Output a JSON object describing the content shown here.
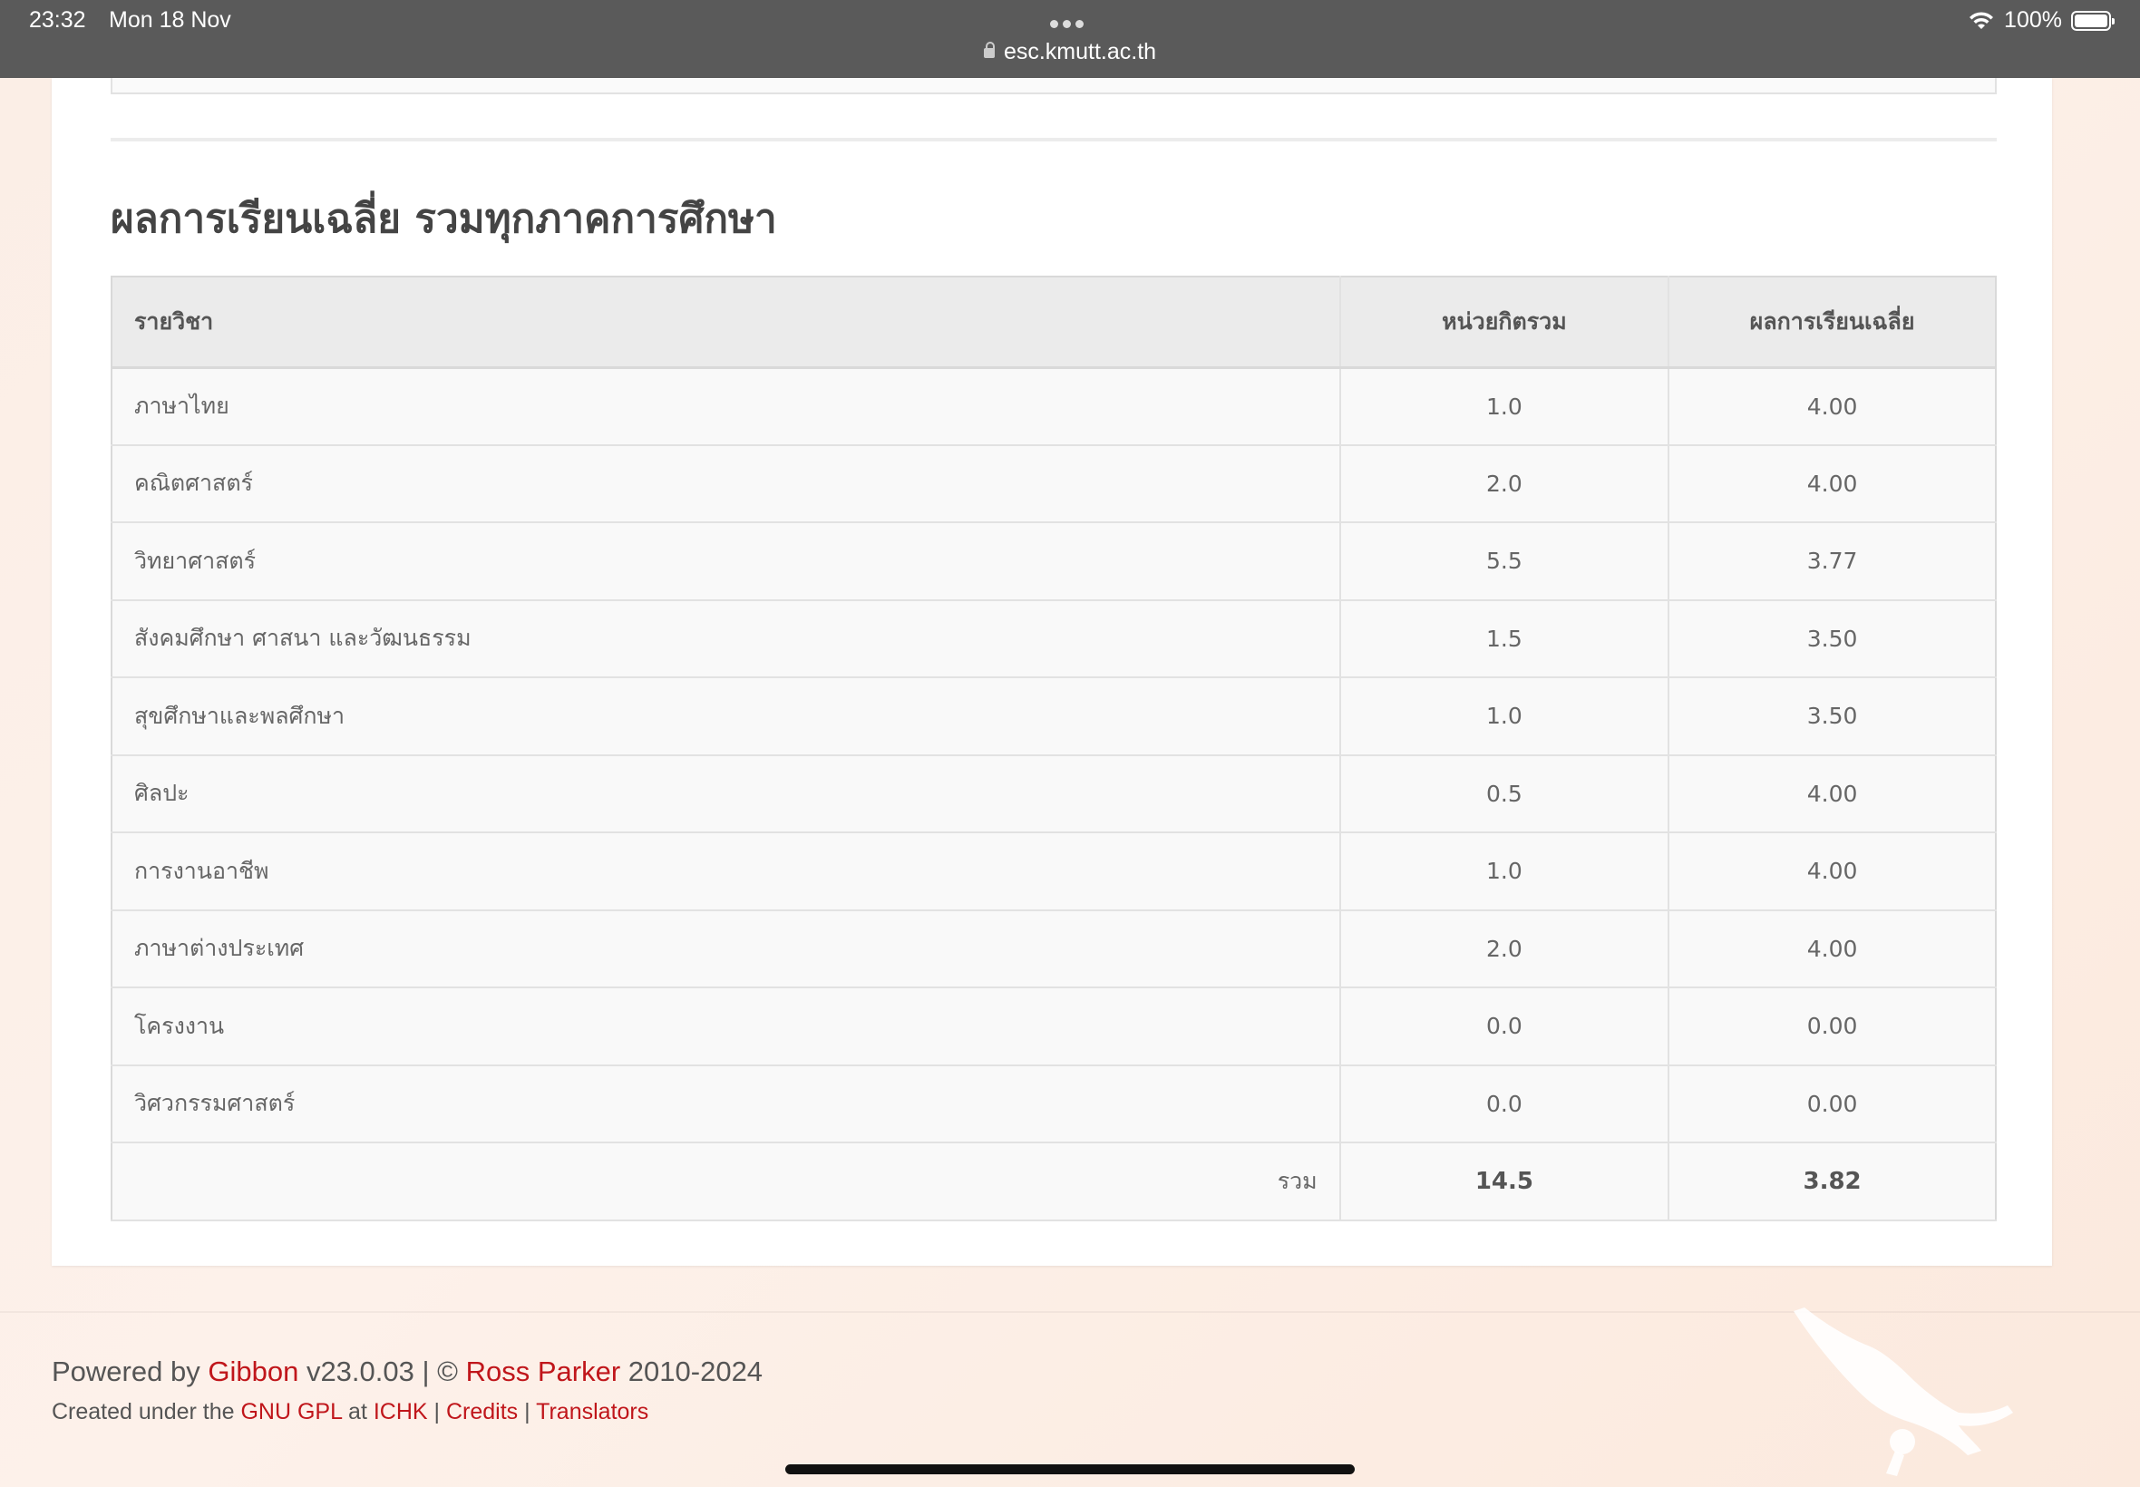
{
  "status_bar": {
    "time": "23:32",
    "date": "Mon 18 Nov",
    "url": "esc.kmutt.ac.th",
    "battery": "100%"
  },
  "section": {
    "title": "ผลการเรียนเฉลี่ย รวมทุกภาคการศึกษา"
  },
  "table": {
    "headers": {
      "subject": "รายวิชา",
      "credits": "หน่วยกิตรวม",
      "gpa": "ผลการเรียนเฉลี่ย"
    },
    "rows": [
      {
        "subject": "ภาษาไทย",
        "credits": "1.0",
        "gpa": "4.00"
      },
      {
        "subject": "คณิตศาสตร์",
        "credits": "2.0",
        "gpa": "4.00"
      },
      {
        "subject": "วิทยาศาสตร์",
        "credits": "5.5",
        "gpa": "3.77"
      },
      {
        "subject": "สังคมศึกษา ศาสนา และวัฒนธรรม",
        "credits": "1.5",
        "gpa": "3.50"
      },
      {
        "subject": "สุขศึกษาและพลศึกษา",
        "credits": "1.0",
        "gpa": "3.50"
      },
      {
        "subject": "ศิลปะ",
        "credits": "0.5",
        "gpa": "4.00"
      },
      {
        "subject": "การงานอาชีพ",
        "credits": "1.0",
        "gpa": "4.00"
      },
      {
        "subject": "ภาษาต่างประเทศ",
        "credits": "2.0",
        "gpa": "4.00"
      },
      {
        "subject": "โครงงาน",
        "credits": "0.0",
        "gpa": "0.00"
      },
      {
        "subject": "วิศวกรรมศาสตร์",
        "credits": "0.0",
        "gpa": "0.00"
      }
    ],
    "total": {
      "label": "รวม",
      "credits": "14.5",
      "gpa": "3.82"
    }
  },
  "footer": {
    "powered_by": "Powered by",
    "gibbon": "Gibbon",
    "version": "v23.0.03 | ©",
    "author": "Ross Parker",
    "years": "2010-2024",
    "created_under": "Created under the",
    "gpl": "GNU GPL",
    "at": "at",
    "ichk": "ICHK",
    "sep1": "|",
    "credits": "Credits",
    "sep2": "|",
    "translators": "Translators"
  },
  "colors": {
    "link": "#c0161b",
    "status_bar": "#5a5a5a"
  }
}
